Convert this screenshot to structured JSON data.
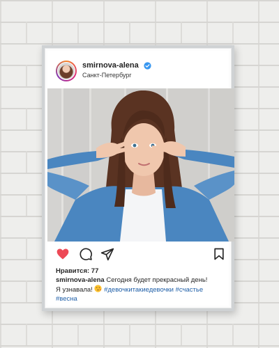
{
  "post": {
    "username": "smirnova-alena",
    "location": "Санкт-Петербург",
    "likes_label": "Нравится: 77",
    "caption_user": "smirnova-alena",
    "caption_text_1": "Сегодня будет прекрасный день!",
    "caption_text_2": "Я узнавала!",
    "hashtag_1": "#девочкитакиедевочки",
    "hashtag_2": "#счастье",
    "hashtag_3": "#весна"
  },
  "icons": {
    "like": "heart-icon",
    "comment": "comment-icon",
    "share": "send-icon",
    "save": "bookmark-icon",
    "verified": "verified-badge-icon",
    "emoji": "kiss-emoji-icon"
  },
  "colors": {
    "like_red": "#ed4956",
    "verified_blue": "#3897f0",
    "hashtag_blue": "#1f5fa8",
    "shirt_denim": "#4a86c0"
  }
}
